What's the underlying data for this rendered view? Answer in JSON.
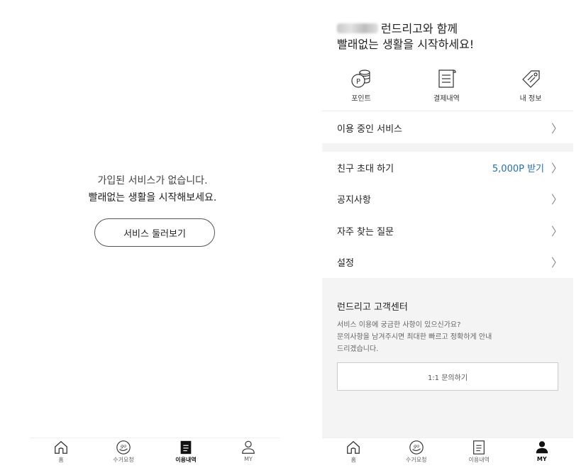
{
  "left": {
    "empty_line1": "가입된 서비스가 없습니다.",
    "empty_line2": "빨래없는 생활을 시작해보세요.",
    "browse_button": "서비스 둘러보기",
    "nav": [
      {
        "label": "홈",
        "icon": "home-icon"
      },
      {
        "label": "수거요청",
        "icon": "pickup-request-icon"
      },
      {
        "label": "이용내역",
        "icon": "usage-history-icon",
        "active": true
      },
      {
        "label": "MY",
        "icon": "user-icon"
      }
    ]
  },
  "right": {
    "greeting_line1": "런드리고와 함께",
    "greeting_line2": "빨래없는 생활을 시작하세요!",
    "quick": [
      {
        "label": "포인트",
        "icon": "points-coin-icon"
      },
      {
        "label": "결제내역",
        "icon": "receipt-icon"
      },
      {
        "label": "내 정보",
        "icon": "tag-icon"
      }
    ],
    "menu": {
      "in_use": "이용 중인 서비스",
      "invite": "친구 초대 하기",
      "invite_reward": "5,000P 받기",
      "notice": "공지사항",
      "faq": "자주 찾는 질문",
      "settings": "설정"
    },
    "support": {
      "title": "런드리고 고객센터",
      "desc1": "서비스 이용에 궁금한 사항이 있으신가요?",
      "desc2": "문의사항을 남겨주시면 최대한 빠르고 정확하게 안내",
      "desc3": "드리겠습니다.",
      "button": "1:1 문의하기"
    },
    "nav": [
      {
        "label": "홈",
        "icon": "home-icon"
      },
      {
        "label": "수거요청",
        "icon": "pickup-request-icon"
      },
      {
        "label": "이용내역",
        "icon": "usage-history-icon"
      },
      {
        "label": "MY",
        "icon": "user-icon",
        "active": true
      }
    ]
  },
  "colors": {
    "accent_link": "#2a6fa8",
    "support_bg": "#f4f4f4"
  }
}
